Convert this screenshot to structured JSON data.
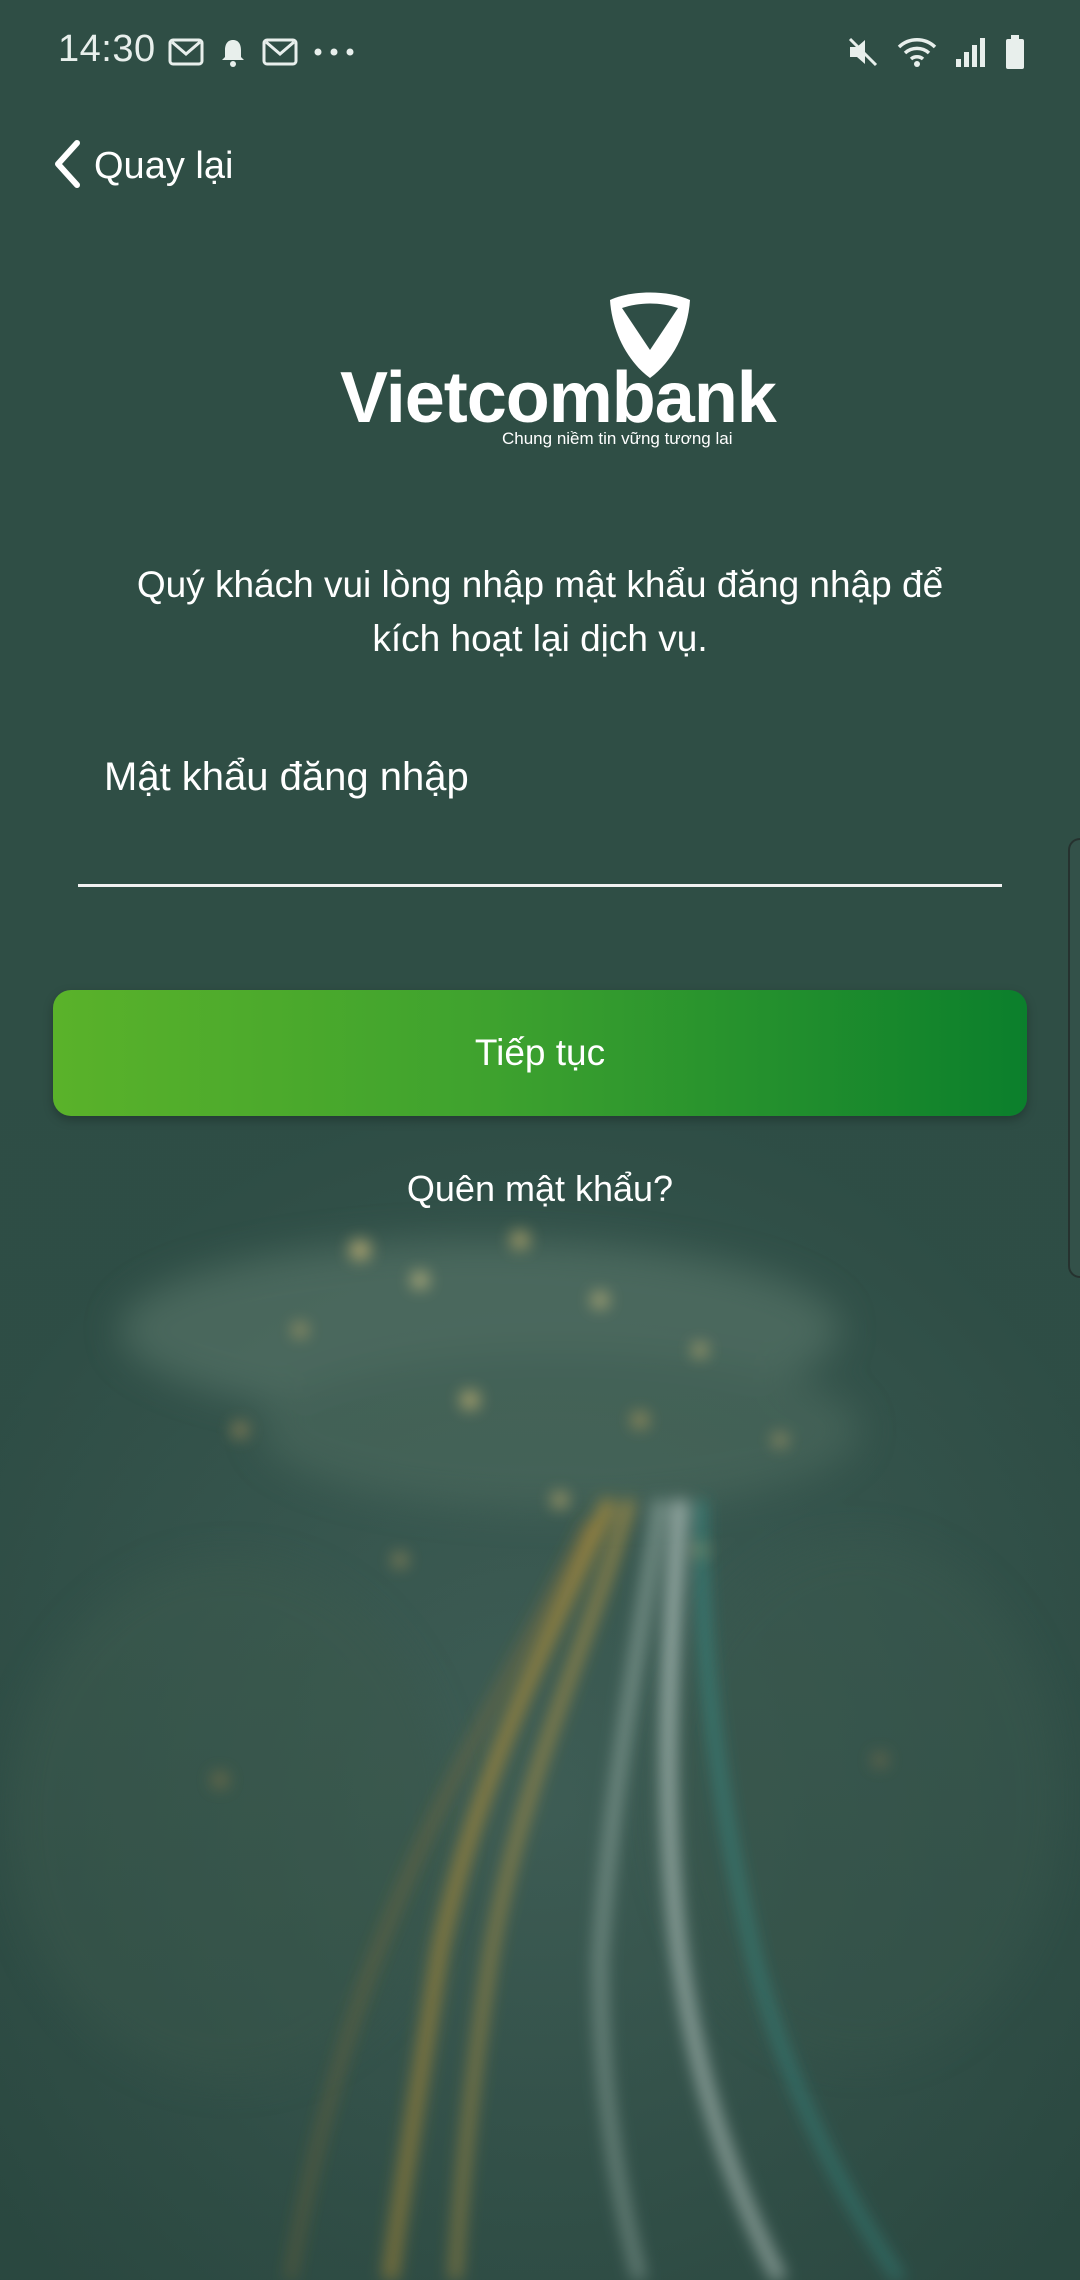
{
  "status_bar": {
    "time": "14:30",
    "left_icons": [
      "gmail-icon",
      "bell-icon",
      "gmail-icon",
      "more-dots-icon"
    ],
    "right_icons": [
      "mute-icon",
      "wifi-icon",
      "signal-icon",
      "battery-icon"
    ]
  },
  "nav": {
    "back_label": "Quay lại"
  },
  "logo": {
    "brand": "Vietcombank",
    "tagline": "Chung niềm tin vững tương lai"
  },
  "instruction": {
    "line1": "Quý khách vui lòng nhập mật khẩu đăng nhập để",
    "line2": "kích hoạt lại dịch vụ."
  },
  "password_field": {
    "placeholder": "Mật khẩu đăng nhập",
    "value": ""
  },
  "continue_button": {
    "label": "Tiếp tục"
  },
  "forgot_link": {
    "label": "Quên mật khẩu?"
  },
  "colors": {
    "background": "#2e4d45",
    "button_start": "#5ab22a",
    "button_end": "#0b7f2c",
    "text": "#ffffff"
  }
}
